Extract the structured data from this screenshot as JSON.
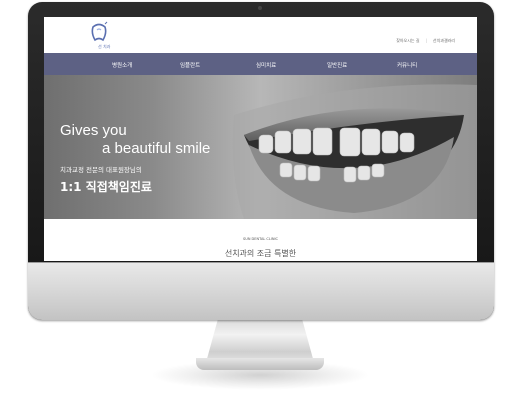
{
  "header": {
    "logo_text": "선 치과",
    "top_links": [
      "찾아오시는 길",
      "선치과갤러리"
    ]
  },
  "nav": {
    "items": [
      "병원소개",
      "임플란트",
      "심미치료",
      "일반진료",
      "커뮤니티"
    ]
  },
  "hero": {
    "title_line1": "Gives you",
    "title_line2": "a beautiful smile",
    "subtitle": "치과교정 전문의 대표원장님의",
    "headline": "1:1 직접책임진료",
    "slide_count": 4,
    "active_slide": 1
  },
  "section": {
    "eyebrow": "SUN DENTAL CLINIC",
    "title": "선치과의 조금 특별한"
  },
  "colors": {
    "nav_bg": "#5d6184",
    "logo_accent": "#5a6fb0",
    "bezel": "#1e1e1e"
  }
}
